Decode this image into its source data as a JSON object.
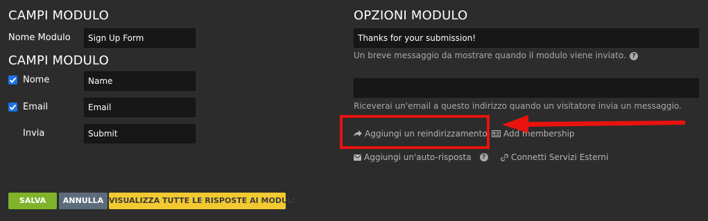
{
  "left": {
    "title_1": "CAMPI MODULO",
    "form_name_label": "Nome Modulo",
    "form_name_value": "Sign Up Form",
    "title_2": "CAMPI MODULO",
    "fields": [
      {
        "label": "Nome",
        "value": "Name",
        "checked": true
      },
      {
        "label": "Email",
        "value": "Email",
        "checked": true
      },
      {
        "label": "Invia",
        "value": "Submit",
        "checked": false
      }
    ]
  },
  "right": {
    "title": "OPZIONI MODULO",
    "message_value": "Thanks for your submission!",
    "message_hint": "Un breve messaggio da mostrare quando il modulo viene inviato.",
    "email_value": "",
    "email_hint": "Riceverai un'email a questo indirizzo quando un visitatore invia un messaggio.",
    "options": {
      "redirect": "Aggiungi un reindirizzamento",
      "membership": "Add membership",
      "autoresponse": "Aggiungi un'auto-risposta",
      "external": "Connetti Servizi Esterni"
    },
    "help_glyph": "?"
  },
  "buttons": {
    "save": "SALVA",
    "cancel": "ANNULLA",
    "view_all": "VISUALIZZA TUTTE LE RISPOSTE AI MODULI"
  },
  "colors": {
    "background": "#2c2c2c",
    "save": "#7eb32a",
    "cancel": "#5d6c7b",
    "view_all": "#f3c931",
    "highlight": "#e8130f",
    "checkbox": "#1a73e8"
  },
  "icons": [
    "check-icon",
    "help-icon",
    "share-arrow-icon",
    "id-card-icon",
    "envelope-icon",
    "link-icon",
    "arrow-annotation"
  ]
}
